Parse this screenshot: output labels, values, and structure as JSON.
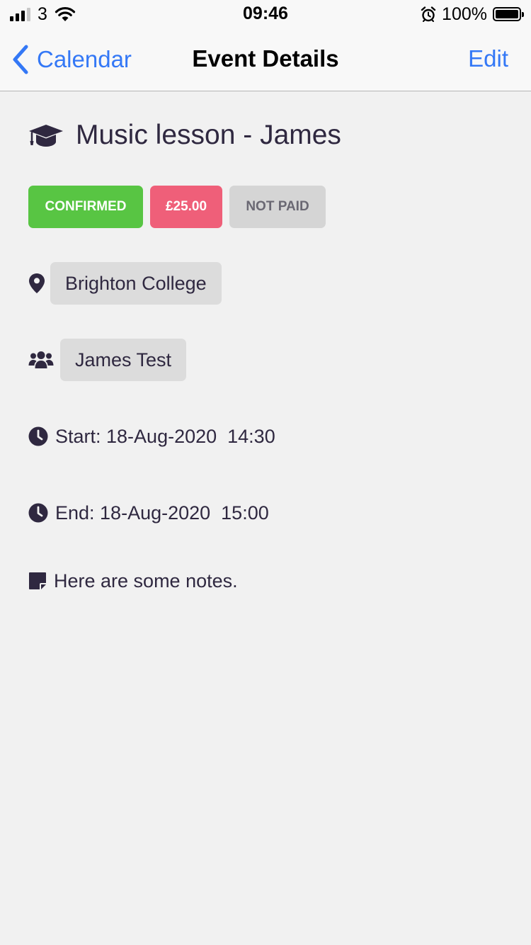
{
  "status_bar": {
    "carrier": "3",
    "time": "09:46",
    "battery_percent": "100%",
    "battery_level": 1.0,
    "signal_bars": 3,
    "icons": [
      "signal-icon",
      "wifi-icon",
      "alarm-icon",
      "battery-icon"
    ]
  },
  "nav": {
    "back_label": "Calendar",
    "title": "Event Details",
    "edit_label": "Edit",
    "accent": "#3478f6"
  },
  "event": {
    "title": "Music lesson - James",
    "title_icon": "graduation-cap-icon",
    "badges": {
      "status": "CONFIRMED",
      "price": "£25.00",
      "payment": "NOT PAID"
    },
    "location": "Brighton College",
    "attendee": "James Test",
    "start": "Start: 18-Aug-2020  14:30",
    "end": "End: 18-Aug-2020  15:00",
    "notes": "Here are some notes."
  },
  "colors": {
    "confirmed": "#58c543",
    "price": "#ef5f79",
    "not_paid": "#d5d5d5",
    "text": "#2f2840",
    "background": "#f1f1f1"
  }
}
